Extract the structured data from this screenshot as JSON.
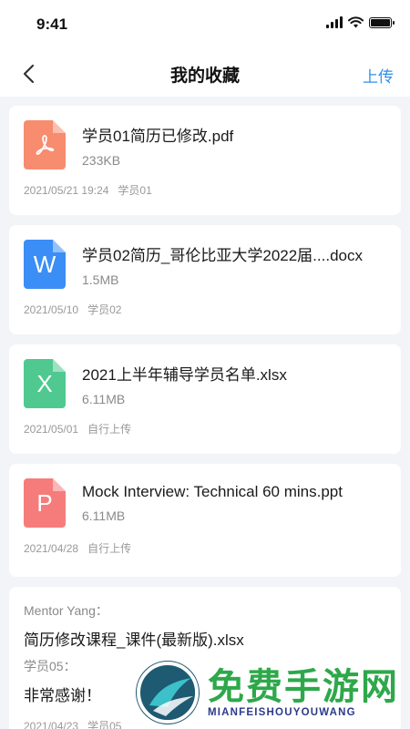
{
  "status_bar": {
    "time": "9:41"
  },
  "nav": {
    "title": "我的收藏",
    "upload_label": "上传"
  },
  "files": [
    {
      "name": "学员01简历已修改.pdf",
      "size": "233KB",
      "date": "2021/05/21 19:24",
      "owner": "学员01",
      "type": "pdf",
      "icon_glyph": "",
      "color": "#f78c6f"
    },
    {
      "name": "学员02简历_哥伦比亚大学2022届....docx",
      "size": "1.5MB",
      "date": "2021/05/10",
      "owner": "学员02",
      "type": "docx",
      "icon_glyph": "W",
      "color": "#3b8ef5"
    },
    {
      "name": "2021上半年辅导学员名单.xlsx",
      "size": "6.11MB",
      "date": "2021/05/01",
      "owner": "自行上传",
      "type": "xlsx",
      "icon_glyph": "X",
      "color": "#4fc990"
    },
    {
      "name": "Mock Interview: Technical 60 mins.ppt",
      "size": "6.11MB",
      "date": "2021/04/28",
      "owner": "自行上传",
      "type": "ppt",
      "icon_glyph": "P",
      "color": "#f67c7c"
    }
  ],
  "comment_item": {
    "from_label": "Mentor Yang：",
    "file_name": "简历修改课程_课件(最新版).xlsx",
    "reply_label": "学员05：",
    "reply_text": "非常感谢！",
    "date": "2021/04/23",
    "owner": "学员05"
  },
  "watermark": {
    "title": "免费手游网",
    "subtitle": "MIANFEISHOUYOUWANG"
  },
  "colors": {
    "accent": "#2f8fe8",
    "background": "#f3f4f7"
  }
}
